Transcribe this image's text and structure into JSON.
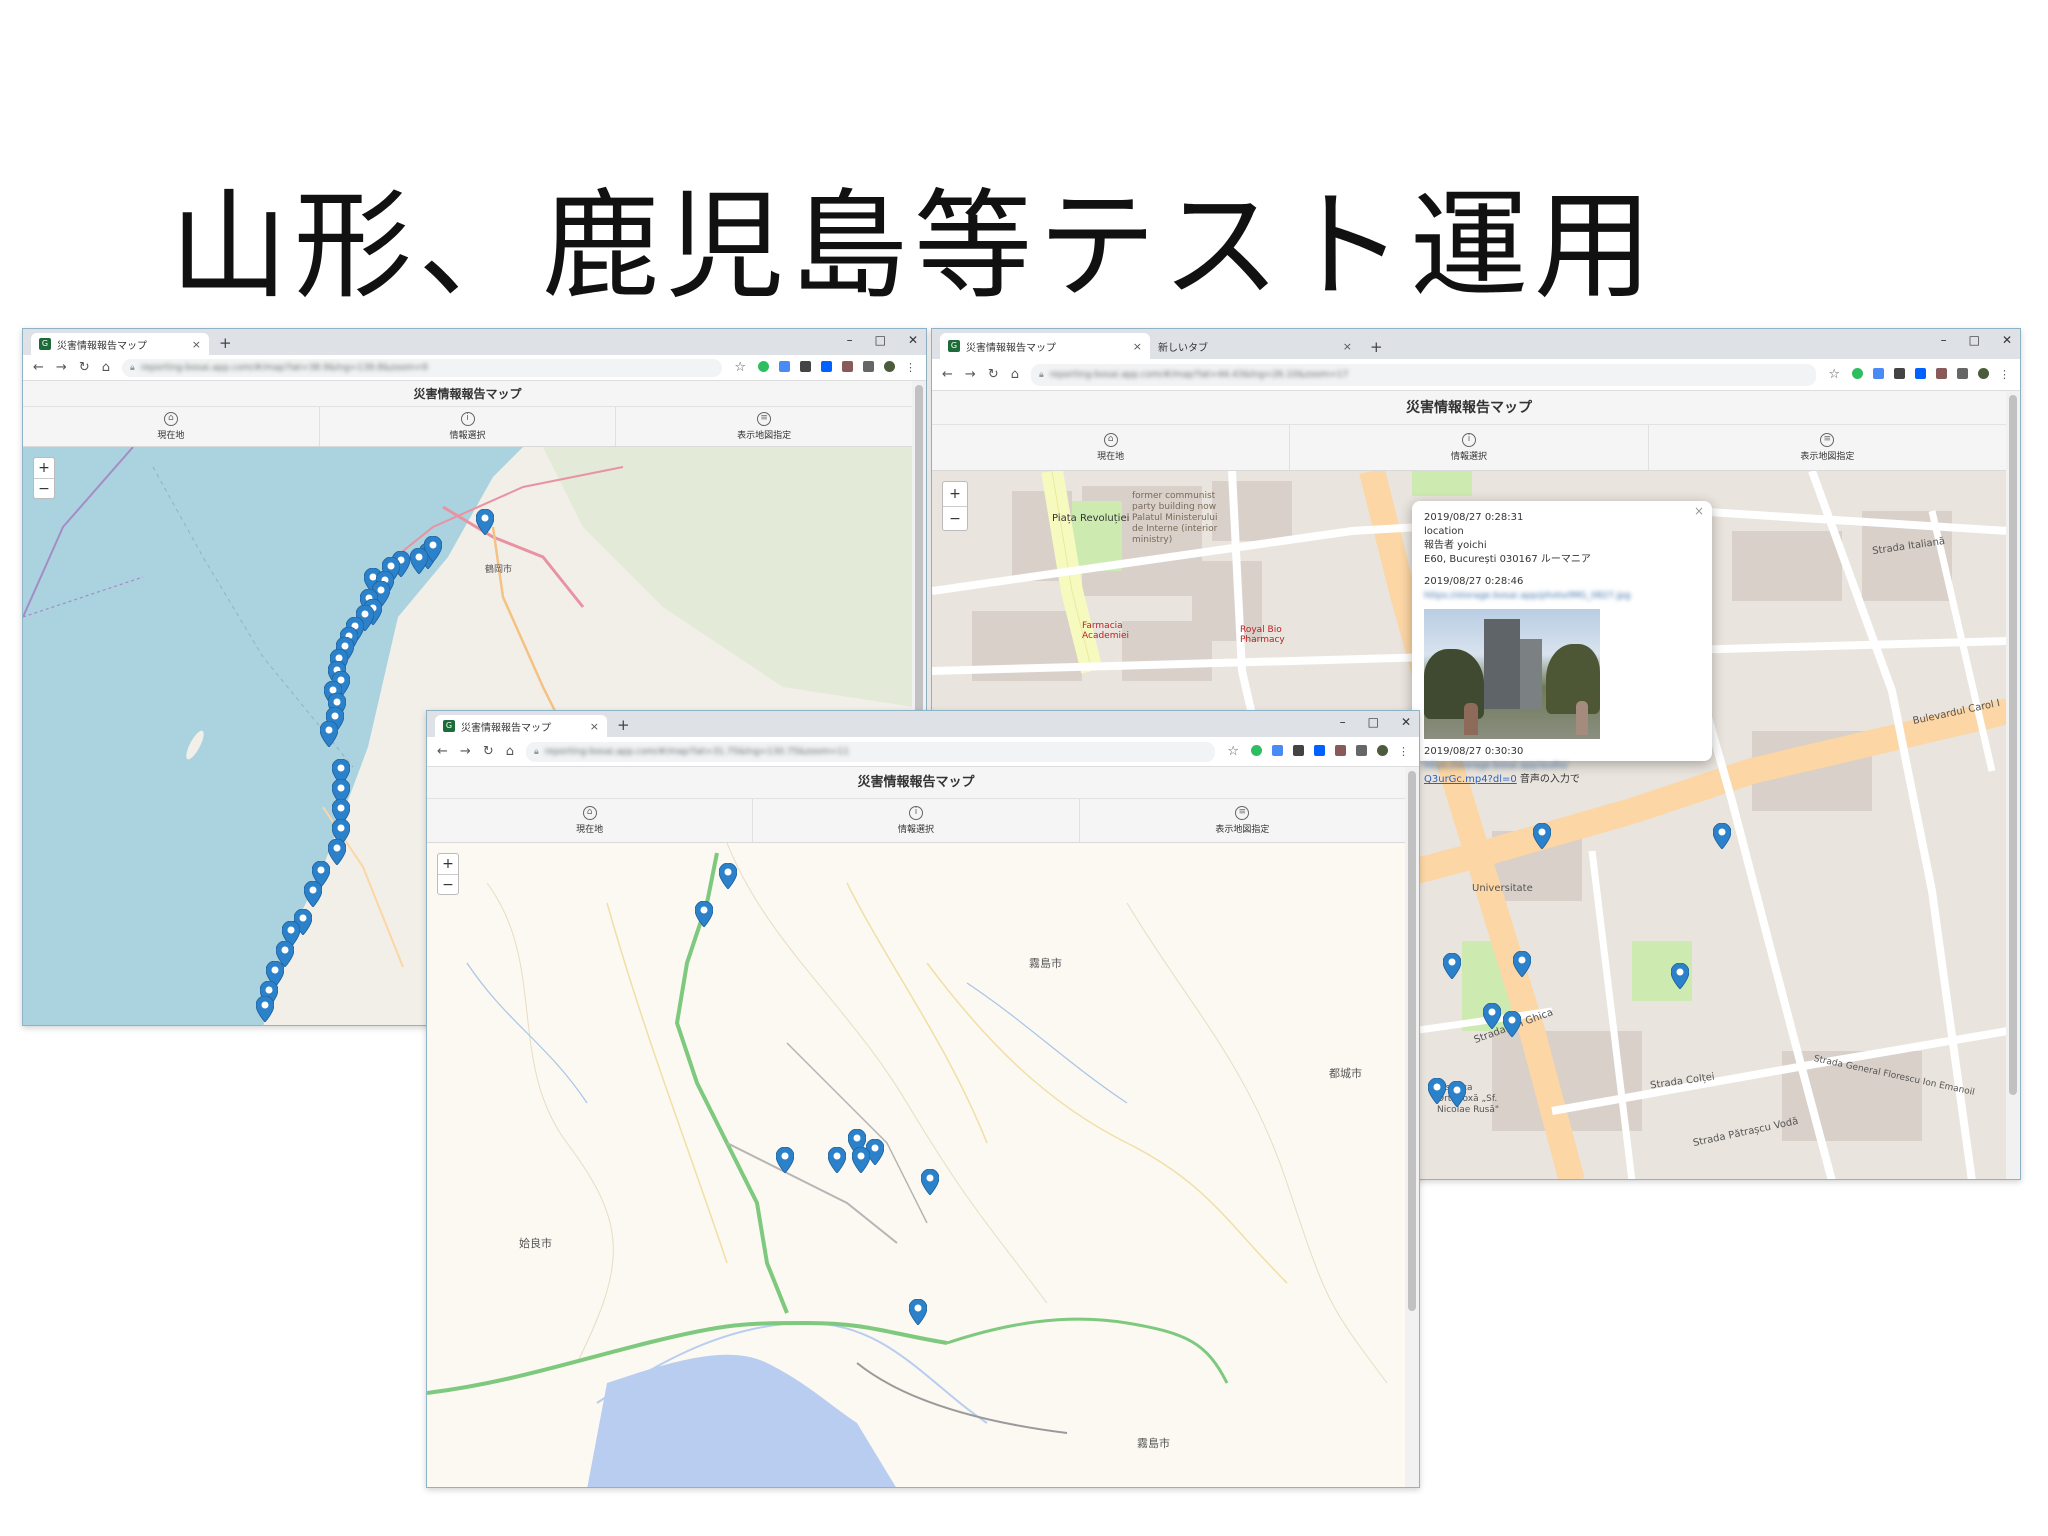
{
  "slide": {
    "title": "山形、鹿児島等テスト運用"
  },
  "windows": {
    "yamagata": {
      "tab_title": "災害情報報告マップ",
      "url": "reporting-bosai.app.com/#/map?lat=38.9&lng=139.8&zoom=9",
      "app_title": "災害情報報告マップ",
      "nav": [
        "現在地",
        "情報選択",
        "表示地図指定"
      ],
      "zoom_in": "+",
      "zoom_out": "−",
      "labels": {
        "tsuruoka": "鶴岡市"
      }
    },
    "bucharest": {
      "tab_title": "災害情報報告マップ",
      "tab2_title": "新しいタブ",
      "url": "reporting-bosai.app.com/#/map?lat=44.43&lng=26.10&zoom=17",
      "app_title": "災害情報報告マップ",
      "nav": [
        "現在地",
        "情報選択",
        "表示地図指定"
      ],
      "zoom_in": "+",
      "zoom_out": "−",
      "labels": {
        "piata": "Piața Revoluției",
        "former": "former communist party building now Palatul Ministerului de Interne (interior ministry)",
        "royal": "Royal Bio Pharmacy",
        "farmacia": "Farmacia Academiei",
        "italiana": "Strada Italiană",
        "carol": "Bulevardul Carol I",
        "universitate": "Universitate",
        "biserica": "Biserica Ortodoxă „Sf. Nicolae Rusă\"",
        "coltei": "Strada Colței",
        "patrascu": "Strada Pătrașcu Vodă",
        "ghica": "Strada Ion Ghica",
        "cj": "Strada General Florescu Ion Emanoil"
      },
      "popup": {
        "entry1_time": "2019/08/27 0:28:31",
        "entry1_type": "location",
        "entry1_sender": "報告者 yoichi",
        "entry1_address": "E60, București 030167 ルーマニア",
        "entry2_time": "2019/08/27 0:28:46",
        "entry2_link": "https://storage.bosai.app/photo/IMG_0827.jpg",
        "entry3_time": "2019/08/27 0:30:30",
        "entry3_link": "https://storage.bosai.app/audio/",
        "entry3_file": "Q3urGc.mp4?dl=0",
        "entry3_note": "音声の入力で",
        "close": "×"
      }
    },
    "kagoshima": {
      "tab_title": "災害情報報告マップ",
      "url": "reporting-bosai.app.com/#/map?lat=31.75&lng=130.75&zoom=11",
      "app_title": "災害情報報告マップ",
      "nav": [
        "現在地",
        "情報選択",
        "表示地図指定"
      ],
      "zoom_in": "+",
      "zoom_out": "−",
      "labels": {
        "kirishima1": "霧島市",
        "miyakonojo": "都城市",
        "aira": "姶良市",
        "kirishima2": "霧島市"
      }
    }
  },
  "colors": {
    "marker": "#2b82cb",
    "sea": "#aad3df",
    "land_osm": "#f2efe9",
    "gsi_land": "#fbf9f2",
    "gsi_sea": "#b8cdf0"
  }
}
